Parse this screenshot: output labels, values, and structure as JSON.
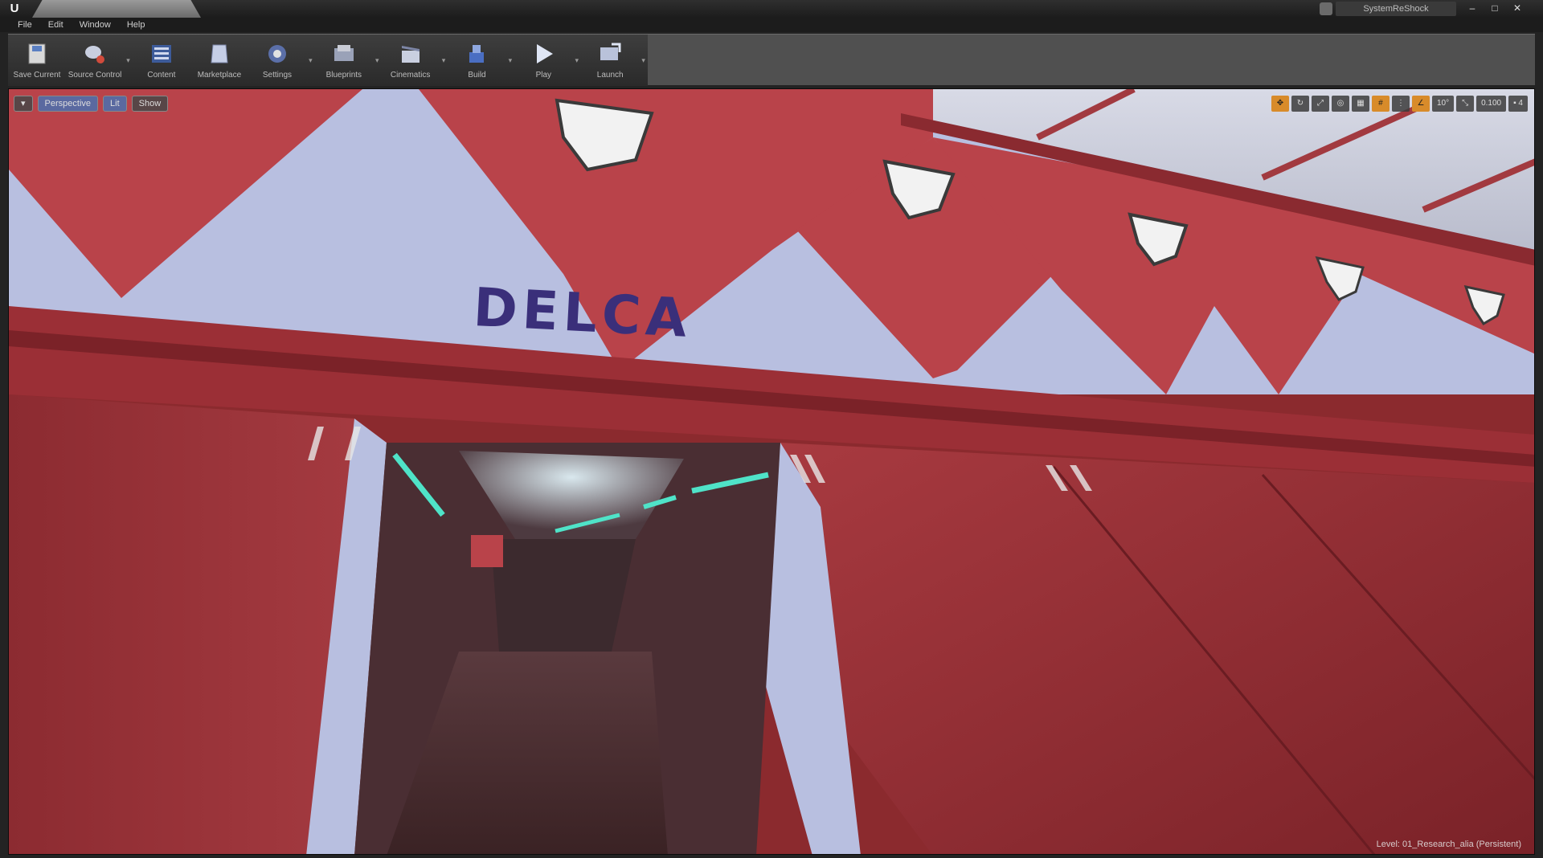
{
  "titlebar": {
    "app_icon": "unreal-engine-logo",
    "tab_label": "",
    "window_title": "SystemReShock",
    "minimize": "–",
    "maximize": "□",
    "close": "✕"
  },
  "menu": {
    "items": [
      "File",
      "Edit",
      "Window",
      "Help"
    ]
  },
  "toolbar": {
    "buttons": [
      {
        "label": "Save Current",
        "icon": "save-icon"
      },
      {
        "label": "Source Control",
        "icon": "source-control-icon"
      },
      {
        "label": "Content",
        "icon": "content-icon"
      },
      {
        "label": "Marketplace",
        "icon": "marketplace-icon"
      },
      {
        "label": "Settings",
        "icon": "settings-icon"
      },
      {
        "label": "Blueprints",
        "icon": "blueprints-icon"
      },
      {
        "label": "Cinematics",
        "icon": "cinematics-icon"
      },
      {
        "label": "Build",
        "icon": "build-icon"
      },
      {
        "label": "Play",
        "icon": "play-icon"
      },
      {
        "label": "Launch",
        "icon": "launch-icon"
      }
    ]
  },
  "viewport": {
    "options_icon": "▾",
    "view_mode": "Perspective",
    "lit_mode": "Lit",
    "show_label": "Show",
    "snap_angle": "10°",
    "camera_speed": "0.100",
    "layout_icon": "▪ 4",
    "sign_text": "DELCA",
    "level_label": "Level:  01_Research_alia (Persistent)",
    "colors": {
      "wall_red": "#b9434a",
      "panel_blue": "#b8bfe0",
      "neon": "#4fe3c8",
      "sign": "#3a2f7a"
    }
  }
}
